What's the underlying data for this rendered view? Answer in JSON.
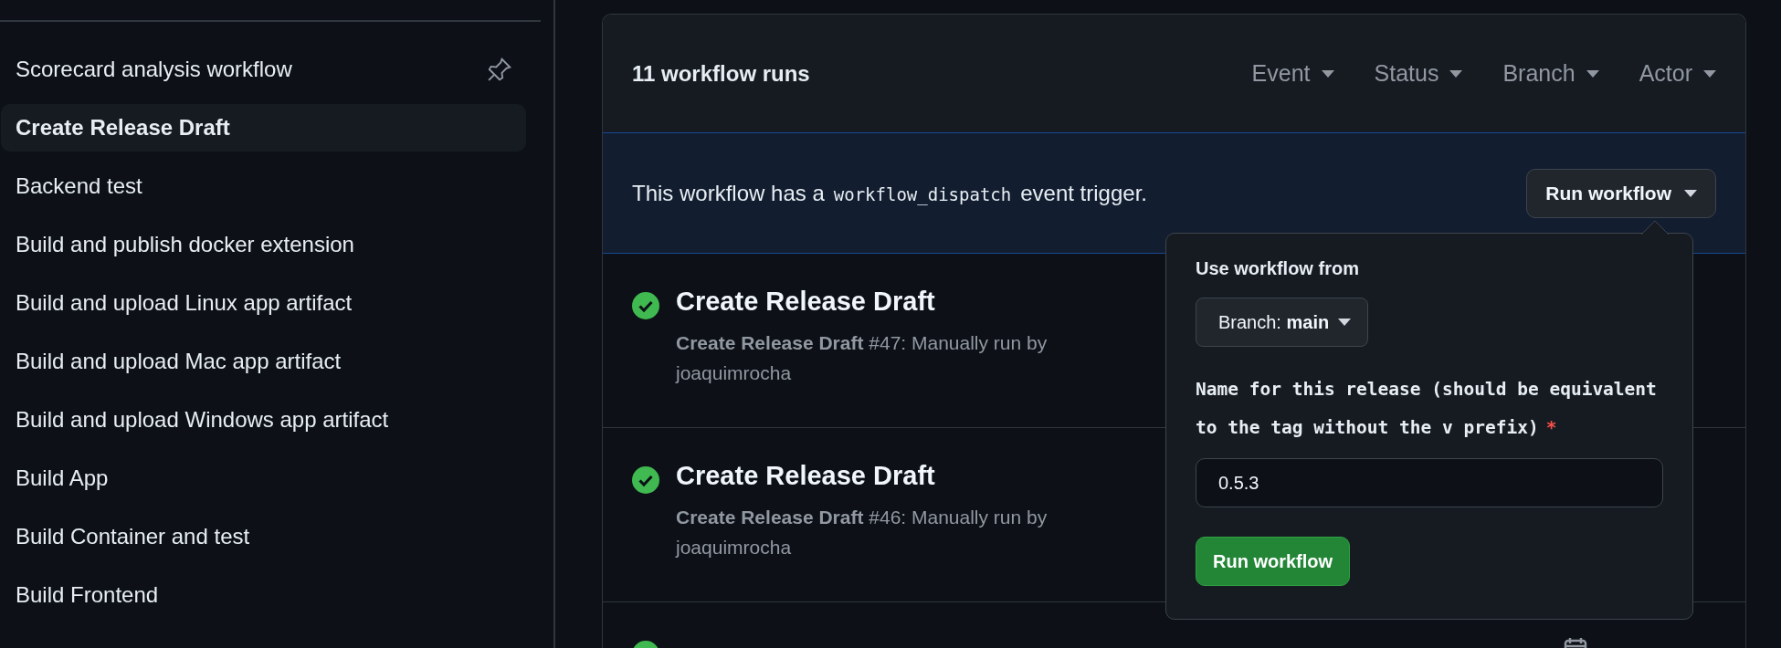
{
  "sidebar": {
    "items": [
      {
        "label": "Scorecard analysis workflow",
        "selected": false,
        "pinned": true
      },
      {
        "label": "Create Release Draft",
        "selected": true,
        "pinned": false
      },
      {
        "label": "Backend test",
        "selected": false,
        "pinned": false
      },
      {
        "label": "Build and publish docker extension",
        "selected": false,
        "pinned": false
      },
      {
        "label": "Build and upload Linux app artifact",
        "selected": false,
        "pinned": false
      },
      {
        "label": "Build and upload Mac app artifact",
        "selected": false,
        "pinned": false
      },
      {
        "label": "Build and upload Windows app artifact",
        "selected": false,
        "pinned": false
      },
      {
        "label": "Build App",
        "selected": false,
        "pinned": false
      },
      {
        "label": "Build Container and test",
        "selected": false,
        "pinned": false
      },
      {
        "label": "Build Frontend",
        "selected": false,
        "pinned": false
      }
    ]
  },
  "runs_header": {
    "count": "11 workflow runs",
    "filters": [
      "Event",
      "Status",
      "Branch",
      "Actor"
    ]
  },
  "dispatch_banner": {
    "text_before": "This workflow has a",
    "code": "workflow_dispatch",
    "text_after": "event trigger.",
    "button": "Run workflow"
  },
  "runs": [
    {
      "kind": "success",
      "title": "Create Release Draft",
      "subtitle": "**Create Release Draft** #47: Manually run by joaquimrocha"
    },
    {
      "kind": "success",
      "title": "Create Release Draft",
      "subtitle": "**Create Release Draft** #46: Manually run by joaquimrocha"
    },
    {
      "kind": "success"
    }
  ],
  "run_popup": {
    "title": "Use workflow from",
    "branch_button": "Branch: **main**",
    "input_label": "Name for this release (should be equivalent to the tag without the v prefix)",
    "required_mark": "*",
    "input_value": "0.5.3",
    "submit": "Run workflow"
  }
}
